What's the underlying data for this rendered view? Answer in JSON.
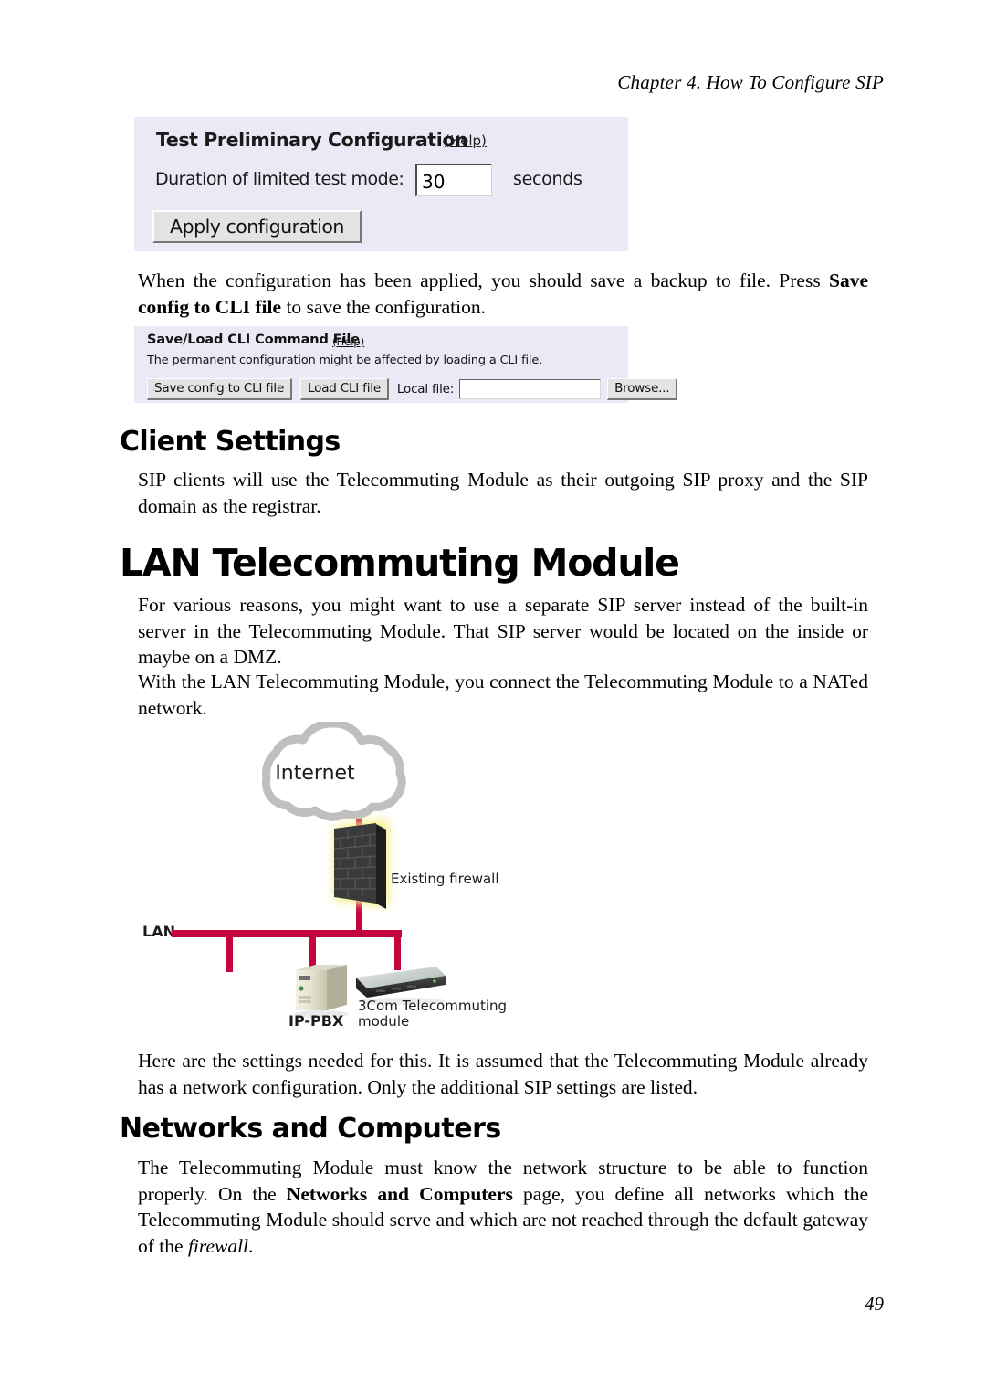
{
  "running_head": "Chapter 4. How To Configure SIP",
  "page_number": "49",
  "colors": {
    "panel_background": "#eaeaf7",
    "button_face": "#e3e3e3",
    "network_line": "#c4043c",
    "cloud_outline": "#bfbfbf",
    "firewall_glow": "#f5f0a0"
  },
  "panel_test_config": {
    "title": "Test Preliminary Configuration",
    "help_link": "(Help)",
    "duration_label": "Duration of limited test mode:",
    "duration_value": "30",
    "duration_placeholder": "",
    "unit_label": "seconds",
    "apply_button": "Apply configuration"
  },
  "panel_cli_file": {
    "title": "Save/Load CLI Command File",
    "help_link": "(Help)",
    "note": "The permanent configuration might be affected by loading a CLI file.",
    "save_button": "Save config to CLI file",
    "load_button": "Load CLI file",
    "local_file_label": "Local file:",
    "local_file_value": "",
    "local_file_placeholder": "",
    "browse_button": "Browse..."
  },
  "body": {
    "para_backup": {
      "part1": "When the configuration has been applied, you should save a backup to file. Press ",
      "bold1": "Save config to CLI file",
      "part2": " to save the configuration."
    },
    "heading_client_settings": "Client Settings",
    "para_sip_clients": "SIP clients will use the Telecommuting Module as their outgoing SIP proxy and the SIP domain as the registrar.",
    "heading_lan_module": "LAN Telecommuting Module",
    "para_various_reasons": "For various reasons, you might want to use a separate SIP server instead of the built-in server in the Telecommuting Module. That SIP server would be located on the inside or maybe on a DMZ.",
    "para_with_lan": "With the LAN Telecommuting Module, you connect the Telecommuting Module to a NATed network.",
    "para_here_are": "Here are the settings needed for this. It is assumed that the Telecommuting Module already has a network configuration. Only the additional SIP settings are listed.",
    "heading_networks_computers": "Networks and Computers",
    "para_must_know": {
      "part1": "The Telecommuting Module must know the network structure to be able to function properly. On the ",
      "bold1": "Networks and Computers",
      "part2": " page, you define all networks which the Telecommuting Module should serve and which are not reached through the default gateway of the ",
      "italic1": "firewall",
      "part3": "."
    }
  },
  "diagram": {
    "internet_label": "Internet",
    "firewall_label": "Existing firewall",
    "lan_label": "LAN",
    "ippbx_label": "IP-PBX",
    "module_label_line1": "3Com Telecommuting",
    "module_label_line2": "module"
  }
}
